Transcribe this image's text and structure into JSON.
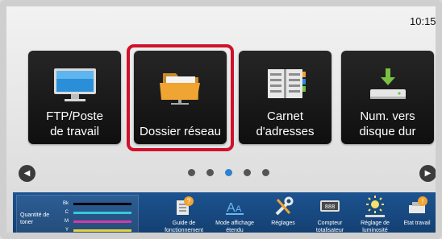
{
  "status": {
    "time": "10:15",
    "side_tab_icon": "chevron-left-icon"
  },
  "tiles": [
    {
      "label": "FTP/Poste de travail",
      "line1": "FTP/Poste",
      "line2": "de travail",
      "icon": "monitor-icon"
    },
    {
      "label": "Dossier réseau",
      "line1": "Dossier réseau",
      "line2": "",
      "icon": "folder-icon",
      "selected": true
    },
    {
      "label": "Carnet d'adresses",
      "line1": "Carnet",
      "line2": "d'adresses",
      "icon": "address-book-icon"
    },
    {
      "label": "Num. vers disque dur",
      "line1": "Num. vers",
      "line2": "disque dur",
      "icon": "download-to-disk-icon"
    }
  ],
  "pagination": {
    "count": 5,
    "active_index": 2
  },
  "colors": {
    "selection_frame": "#d0112b",
    "active_dot": "#2f80d1",
    "tile_bg": "#1a1a1a",
    "bottom_bar": "#1c5390"
  },
  "toner": {
    "title": "Quantité de toner",
    "rows": [
      {
        "name": "Bk",
        "color": "#000000"
      },
      {
        "name": "C",
        "color": "#35c9d9"
      },
      {
        "name": "M",
        "color": "#d23aa8"
      },
      {
        "name": "Y",
        "color": "#e6d23b"
      }
    ]
  },
  "bottom_items": [
    {
      "label": "Guide de fonctionnement",
      "icon": "guide-icon"
    },
    {
      "label": "Mode affichage étendu",
      "icon": "text-size-icon"
    },
    {
      "label": "Réglages",
      "icon": "settings-tools-icon"
    },
    {
      "label": "Compteur totalisateur",
      "icon": "counter-icon"
    },
    {
      "label": "Réglage de luminosité",
      "icon": "brightness-icon"
    },
    {
      "label": "Etat travail",
      "icon": "job-status-icon"
    }
  ]
}
